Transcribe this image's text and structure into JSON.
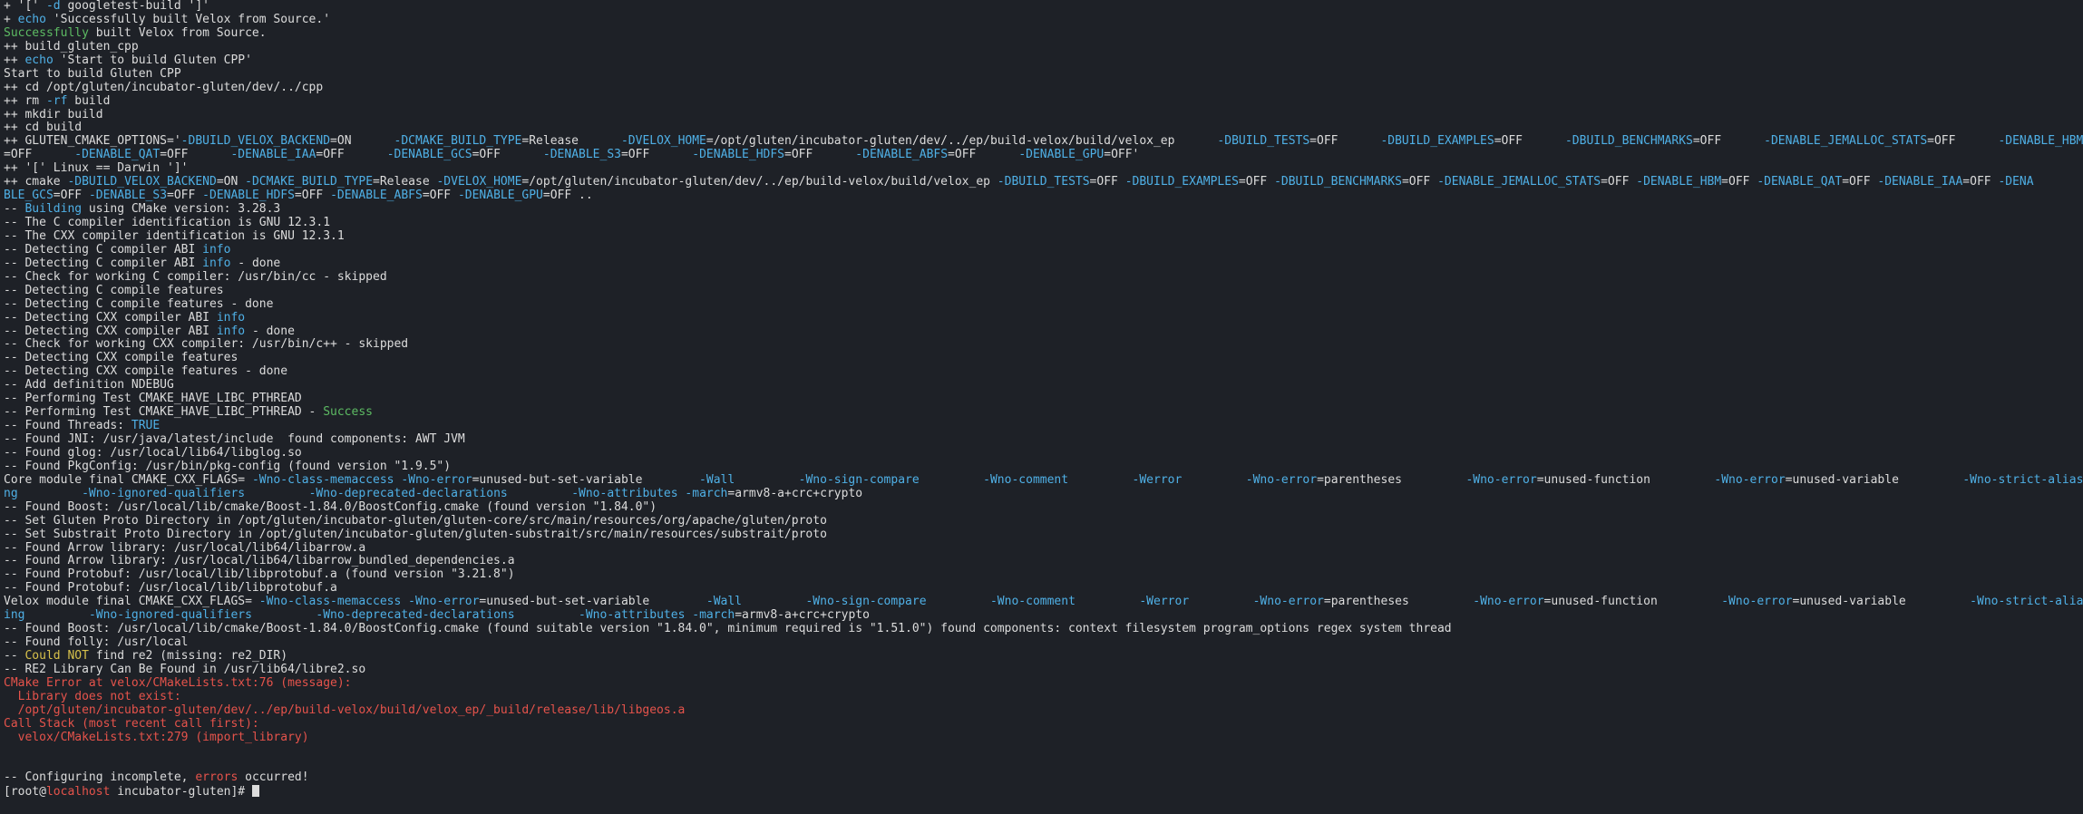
{
  "colors": {
    "background": "#1e2127",
    "default": "#dcdcdc",
    "cyan": "#4fb0e6",
    "green": "#5dbb63",
    "red": "#e5534b",
    "yellow": "#d7c14b"
  },
  "lines": [
    [
      {
        "t": "+ '[' ",
        "c": "default"
      },
      {
        "t": "-d",
        "c": "cyan"
      },
      {
        "t": " googletest-build ']'",
        "c": "default"
      }
    ],
    [
      {
        "t": "+ ",
        "c": "default"
      },
      {
        "t": "echo",
        "c": "cyan"
      },
      {
        "t": " 'Successfully built Velox from Source.'",
        "c": "default"
      }
    ],
    [
      {
        "t": "Successfully",
        "c": "green"
      },
      {
        "t": " built Velox from Source.",
        "c": "default"
      }
    ],
    [
      {
        "t": "++ build_gluten_cpp",
        "c": "default"
      }
    ],
    [
      {
        "t": "++ ",
        "c": "default"
      },
      {
        "t": "echo",
        "c": "cyan"
      },
      {
        "t": " 'Start to build Gluten CPP'",
        "c": "default"
      }
    ],
    [
      {
        "t": "Start to build Gluten CPP",
        "c": "default"
      }
    ],
    [
      {
        "t": "++ cd /opt/gluten/incubator-gluten/dev/../cpp",
        "c": "default"
      }
    ],
    [
      {
        "t": "++ rm ",
        "c": "default"
      },
      {
        "t": "-rf",
        "c": "cyan"
      },
      {
        "t": " build",
        "c": "default"
      }
    ],
    [
      {
        "t": "++ mkdir build",
        "c": "default"
      }
    ],
    [
      {
        "t": "++ cd build",
        "c": "default"
      }
    ],
    [
      {
        "t": "++ GLUTEN_CMAKE_OPTIONS='",
        "c": "default"
      },
      {
        "t": "-DBUILD_VELOX_BACKEND",
        "c": "cyan"
      },
      {
        "t": "=ON      ",
        "c": "default"
      },
      {
        "t": "-DCMAKE_BUILD_TYPE",
        "c": "cyan"
      },
      {
        "t": "=Release      ",
        "c": "default"
      },
      {
        "t": "-DVELOX_HOME",
        "c": "cyan"
      },
      {
        "t": "=/opt/gluten/incubator-gluten/dev/../ep/build-velox/build/velox_ep      ",
        "c": "default"
      },
      {
        "t": "-DBUILD_TESTS",
        "c": "cyan"
      },
      {
        "t": "=OFF      ",
        "c": "default"
      },
      {
        "t": "-DBUILD_EXAMPLES",
        "c": "cyan"
      },
      {
        "t": "=OFF      ",
        "c": "default"
      },
      {
        "t": "-DBUILD_BENCHMARKS",
        "c": "cyan"
      },
      {
        "t": "=OFF      ",
        "c": "default"
      },
      {
        "t": "-DENABLE_JEMALLOC_STATS",
        "c": "cyan"
      },
      {
        "t": "=OFF      ",
        "c": "default"
      },
      {
        "t": "-DENABLE_HBM",
        "c": "cyan"
      }
    ],
    [
      {
        "t": "=OFF      ",
        "c": "default"
      },
      {
        "t": "-DENABLE_QAT",
        "c": "cyan"
      },
      {
        "t": "=OFF      ",
        "c": "default"
      },
      {
        "t": "-DENABLE_IAA",
        "c": "cyan"
      },
      {
        "t": "=OFF      ",
        "c": "default"
      },
      {
        "t": "-DENABLE_GCS",
        "c": "cyan"
      },
      {
        "t": "=OFF      ",
        "c": "default"
      },
      {
        "t": "-DENABLE_S3",
        "c": "cyan"
      },
      {
        "t": "=OFF      ",
        "c": "default"
      },
      {
        "t": "-DENABLE_HDFS",
        "c": "cyan"
      },
      {
        "t": "=OFF      ",
        "c": "default"
      },
      {
        "t": "-DENABLE_ABFS",
        "c": "cyan"
      },
      {
        "t": "=OFF      ",
        "c": "default"
      },
      {
        "t": "-DENABLE_GPU",
        "c": "cyan"
      },
      {
        "t": "=OFF'",
        "c": "default"
      }
    ],
    [
      {
        "t": "++ '[' Linux == Darwin ']'",
        "c": "default"
      }
    ],
    [
      {
        "t": "++ cmake ",
        "c": "default"
      },
      {
        "t": "-DBUILD_VELOX_BACKEND",
        "c": "cyan"
      },
      {
        "t": "=ON ",
        "c": "default"
      },
      {
        "t": "-DCMAKE_BUILD_TYPE",
        "c": "cyan"
      },
      {
        "t": "=Release ",
        "c": "default"
      },
      {
        "t": "-DVELOX_HOME",
        "c": "cyan"
      },
      {
        "t": "=/opt/gluten/incubator-gluten/dev/../ep/build-velox/build/velox_ep ",
        "c": "default"
      },
      {
        "t": "-DBUILD_TESTS",
        "c": "cyan"
      },
      {
        "t": "=OFF ",
        "c": "default"
      },
      {
        "t": "-DBUILD_EXAMPLES",
        "c": "cyan"
      },
      {
        "t": "=OFF ",
        "c": "default"
      },
      {
        "t": "-DBUILD_BENCHMARKS",
        "c": "cyan"
      },
      {
        "t": "=OFF ",
        "c": "default"
      },
      {
        "t": "-DENABLE_JEMALLOC_STATS",
        "c": "cyan"
      },
      {
        "t": "=OFF ",
        "c": "default"
      },
      {
        "t": "-DENABLE_HBM",
        "c": "cyan"
      },
      {
        "t": "=OFF ",
        "c": "default"
      },
      {
        "t": "-DENABLE_QAT",
        "c": "cyan"
      },
      {
        "t": "=OFF ",
        "c": "default"
      },
      {
        "t": "-DENABLE_IAA",
        "c": "cyan"
      },
      {
        "t": "=OFF ",
        "c": "default"
      },
      {
        "t": "-DENA",
        "c": "cyan"
      }
    ],
    [
      {
        "t": "BLE_GCS",
        "c": "cyan"
      },
      {
        "t": "=OFF ",
        "c": "default"
      },
      {
        "t": "-DENABLE_S3",
        "c": "cyan"
      },
      {
        "t": "=OFF ",
        "c": "default"
      },
      {
        "t": "-DENABLE_HDFS",
        "c": "cyan"
      },
      {
        "t": "=OFF ",
        "c": "default"
      },
      {
        "t": "-DENABLE_ABFS",
        "c": "cyan"
      },
      {
        "t": "=OFF ",
        "c": "default"
      },
      {
        "t": "-DENABLE_GPU",
        "c": "cyan"
      },
      {
        "t": "=OFF ..",
        "c": "default"
      }
    ],
    [
      {
        "t": "-- ",
        "c": "default"
      },
      {
        "t": "Building",
        "c": "cyan"
      },
      {
        "t": " using CMake version: 3.28.3",
        "c": "default"
      }
    ],
    [
      {
        "t": "-- The C compiler identification is GNU 12.3.1",
        "c": "default"
      }
    ],
    [
      {
        "t": "-- The CXX compiler identification is GNU 12.3.1",
        "c": "default"
      }
    ],
    [
      {
        "t": "-- Detecting C compiler ABI ",
        "c": "default"
      },
      {
        "t": "info",
        "c": "cyan"
      }
    ],
    [
      {
        "t": "-- Detecting C compiler ABI ",
        "c": "default"
      },
      {
        "t": "info",
        "c": "cyan"
      },
      {
        "t": " - done",
        "c": "default"
      }
    ],
    [
      {
        "t": "-- Check for working C compiler: /usr/bin/cc - skipped",
        "c": "default"
      }
    ],
    [
      {
        "t": "-- Detecting C compile features",
        "c": "default"
      }
    ],
    [
      {
        "t": "-- Detecting C compile features - done",
        "c": "default"
      }
    ],
    [
      {
        "t": "-- Detecting CXX compiler ABI ",
        "c": "default"
      },
      {
        "t": "info",
        "c": "cyan"
      }
    ],
    [
      {
        "t": "-- Detecting CXX compiler ABI ",
        "c": "default"
      },
      {
        "t": "info",
        "c": "cyan"
      },
      {
        "t": " - done",
        "c": "default"
      }
    ],
    [
      {
        "t": "-- Check for working CXX compiler: /usr/bin/c++ - skipped",
        "c": "default"
      }
    ],
    [
      {
        "t": "-- Detecting CXX compile features",
        "c": "default"
      }
    ],
    [
      {
        "t": "-- Detecting CXX compile features - done",
        "c": "default"
      }
    ],
    [
      {
        "t": "-- Add definition NDEBUG",
        "c": "default"
      }
    ],
    [
      {
        "t": "-- Performing Test CMAKE_HAVE_LIBC_PTHREAD",
        "c": "default"
      }
    ],
    [
      {
        "t": "-- Performing Test CMAKE_HAVE_LIBC_PTHREAD - ",
        "c": "default"
      },
      {
        "t": "Success",
        "c": "green"
      }
    ],
    [
      {
        "t": "-- Found Threads: ",
        "c": "default"
      },
      {
        "t": "TRUE",
        "c": "cyan"
      }
    ],
    [
      {
        "t": "-- Found JNI: /usr/java/latest/include  found components: AWT JVM",
        "c": "default"
      }
    ],
    [
      {
        "t": "-- Found glog: /usr/local/lib64/libglog.so",
        "c": "default"
      }
    ],
    [
      {
        "t": "-- Found PkgConfig: /usr/bin/pkg-config (found version \"1.9.5\")",
        "c": "default"
      }
    ],
    [
      {
        "t": "Core module final CMAKE_CXX_FLAGS= ",
        "c": "default"
      },
      {
        "t": "-Wno-class-memaccess",
        "c": "cyan"
      },
      {
        "t": " ",
        "c": "default"
      },
      {
        "t": "-Wno-error",
        "c": "cyan"
      },
      {
        "t": "=unused-but-set-variable        ",
        "c": "default"
      },
      {
        "t": "-Wall",
        "c": "cyan"
      },
      {
        "t": "         ",
        "c": "default"
      },
      {
        "t": "-Wno-sign-compare",
        "c": "cyan"
      },
      {
        "t": "         ",
        "c": "default"
      },
      {
        "t": "-Wno-comment",
        "c": "cyan"
      },
      {
        "t": "         ",
        "c": "default"
      },
      {
        "t": "-Werror",
        "c": "cyan"
      },
      {
        "t": "         ",
        "c": "default"
      },
      {
        "t": "-Wno-error",
        "c": "cyan"
      },
      {
        "t": "=parentheses         ",
        "c": "default"
      },
      {
        "t": "-Wno-error",
        "c": "cyan"
      },
      {
        "t": "=unused-function         ",
        "c": "default"
      },
      {
        "t": "-Wno-error",
        "c": "cyan"
      },
      {
        "t": "=unused-variable         ",
        "c": "default"
      },
      {
        "t": "-Wno-strict-aliasi",
        "c": "cyan"
      }
    ],
    [
      {
        "t": "ng",
        "c": "cyan"
      },
      {
        "t": "         ",
        "c": "default"
      },
      {
        "t": "-Wno-ignored-qualifiers",
        "c": "cyan"
      },
      {
        "t": "         ",
        "c": "default"
      },
      {
        "t": "-Wno-deprecated-declarations",
        "c": "cyan"
      },
      {
        "t": "         ",
        "c": "default"
      },
      {
        "t": "-Wno-attributes",
        "c": "cyan"
      },
      {
        "t": " ",
        "c": "default"
      },
      {
        "t": "-march",
        "c": "cyan"
      },
      {
        "t": "=armv8-a+crc+crypto",
        "c": "default"
      }
    ],
    [
      {
        "t": "-- Found Boost: /usr/local/lib/cmake/Boost-1.84.0/BoostConfig.cmake (found version \"1.84.0\")",
        "c": "default"
      }
    ],
    [
      {
        "t": "-- Set Gluten Proto Directory in /opt/gluten/incubator-gluten/gluten-core/src/main/resources/org/apache/gluten/proto",
        "c": "default"
      }
    ],
    [
      {
        "t": "-- Set Substrait Proto Directory in /opt/gluten/incubator-gluten/gluten-substrait/src/main/resources/substrait/proto",
        "c": "default"
      }
    ],
    [
      {
        "t": "-- Found Arrow library: /usr/local/lib64/libarrow.a",
        "c": "default"
      }
    ],
    [
      {
        "t": "-- Found Arrow library: /usr/local/lib64/libarrow_bundled_dependencies.a",
        "c": "default"
      }
    ],
    [
      {
        "t": "-- Found Protobuf: /usr/local/lib/libprotobuf.a (found version \"3.21.8\")",
        "c": "default"
      }
    ],
    [
      {
        "t": "-- Found Protobuf: /usr/local/lib/libprotobuf.a",
        "c": "default"
      }
    ],
    [
      {
        "t": "Velox module final CMAKE_CXX_FLAGS= ",
        "c": "default"
      },
      {
        "t": "-Wno-class-memaccess",
        "c": "cyan"
      },
      {
        "t": " ",
        "c": "default"
      },
      {
        "t": "-Wno-error",
        "c": "cyan"
      },
      {
        "t": "=unused-but-set-variable        ",
        "c": "default"
      },
      {
        "t": "-Wall",
        "c": "cyan"
      },
      {
        "t": "         ",
        "c": "default"
      },
      {
        "t": "-Wno-sign-compare",
        "c": "cyan"
      },
      {
        "t": "         ",
        "c": "default"
      },
      {
        "t": "-Wno-comment",
        "c": "cyan"
      },
      {
        "t": "         ",
        "c": "default"
      },
      {
        "t": "-Werror",
        "c": "cyan"
      },
      {
        "t": "         ",
        "c": "default"
      },
      {
        "t": "-Wno-error",
        "c": "cyan"
      },
      {
        "t": "=parentheses         ",
        "c": "default"
      },
      {
        "t": "-Wno-error",
        "c": "cyan"
      },
      {
        "t": "=unused-function         ",
        "c": "default"
      },
      {
        "t": "-Wno-error",
        "c": "cyan"
      },
      {
        "t": "=unused-variable         ",
        "c": "default"
      },
      {
        "t": "-Wno-strict-alias",
        "c": "cyan"
      }
    ],
    [
      {
        "t": "ing",
        "c": "cyan"
      },
      {
        "t": "         ",
        "c": "default"
      },
      {
        "t": "-Wno-ignored-qualifiers",
        "c": "cyan"
      },
      {
        "t": "         ",
        "c": "default"
      },
      {
        "t": "-Wno-deprecated-declarations",
        "c": "cyan"
      },
      {
        "t": "         ",
        "c": "default"
      },
      {
        "t": "-Wno-attributes",
        "c": "cyan"
      },
      {
        "t": " ",
        "c": "default"
      },
      {
        "t": "-march",
        "c": "cyan"
      },
      {
        "t": "=armv8-a+crc+crypto",
        "c": "default"
      }
    ],
    [
      {
        "t": "-- Found Boost: /usr/local/lib/cmake/Boost-1.84.0/BoostConfig.cmake (found suitable version \"1.84.0\", minimum required is \"1.51.0\") found components: context filesystem program_options regex system thread",
        "c": "default"
      }
    ],
    [
      {
        "t": "-- Found folly: /usr/local",
        "c": "default"
      }
    ],
    [
      {
        "t": "-- ",
        "c": "default"
      },
      {
        "t": "Could NOT",
        "c": "yellow"
      },
      {
        "t": " find re2 (missing: re2_DIR)",
        "c": "default"
      }
    ],
    [
      {
        "t": "-- RE2 Library Can Be Found in /usr/lib64/libre2.so",
        "c": "default"
      }
    ],
    [
      {
        "t": "CMake Error at velox/CMakeLists.txt:76 (message):",
        "c": "red"
      }
    ],
    [
      {
        "t": "  Library does not exist:",
        "c": "red"
      }
    ],
    [
      {
        "t": "  /opt/gluten/incubator-gluten/dev/../ep/build-velox/build/velox_ep/_build/release/lib/libgeos.a",
        "c": "red"
      }
    ],
    [
      {
        "t": "Call Stack (most recent call first):",
        "c": "red"
      }
    ],
    [
      {
        "t": "  velox/CMakeLists.txt:279 (import_library)",
        "c": "red"
      }
    ],
    [
      {
        "t": "",
        "c": "default"
      }
    ],
    [
      {
        "t": "",
        "c": "default"
      }
    ],
    [
      {
        "t": "-- Configuring incomplete, ",
        "c": "default"
      },
      {
        "t": "errors",
        "c": "red"
      },
      {
        "t": " occurred!",
        "c": "default"
      }
    ]
  ],
  "prompt": {
    "user": "[root@",
    "host": "localhost",
    "path": " incubator-gluten]# "
  },
  "cursor_icon": "block-cursor-icon"
}
